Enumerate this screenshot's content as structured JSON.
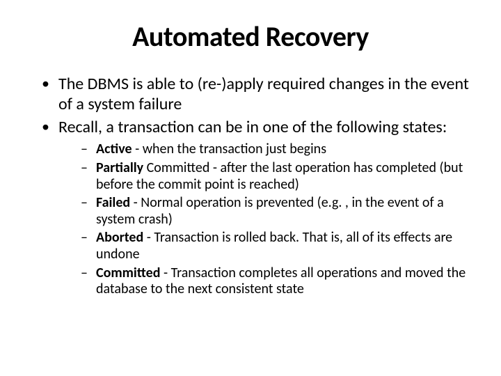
{
  "title": "Automated Recovery",
  "bullets": [
    "The DBMS is able to (re-)apply required changes in the event of a system failure",
    "Recall, a transaction can be in one of the following states:"
  ],
  "states": [
    {
      "term": "Active",
      "desc": " - when the transaction just begins"
    },
    {
      "term": "Partially",
      "desc": " Committed - after the last operation has completed (but before the commit point is reached)"
    },
    {
      "term": "Failed",
      "desc": " - Normal operation is prevented (e.g. , in the event of a system crash)"
    },
    {
      "term": "Aborted",
      "desc": " - Transaction is rolled back. That is, all of its effects are undone"
    },
    {
      "term": "Committed",
      "desc": " - Transaction completes all operations and moved the database to the next consistent state"
    }
  ]
}
